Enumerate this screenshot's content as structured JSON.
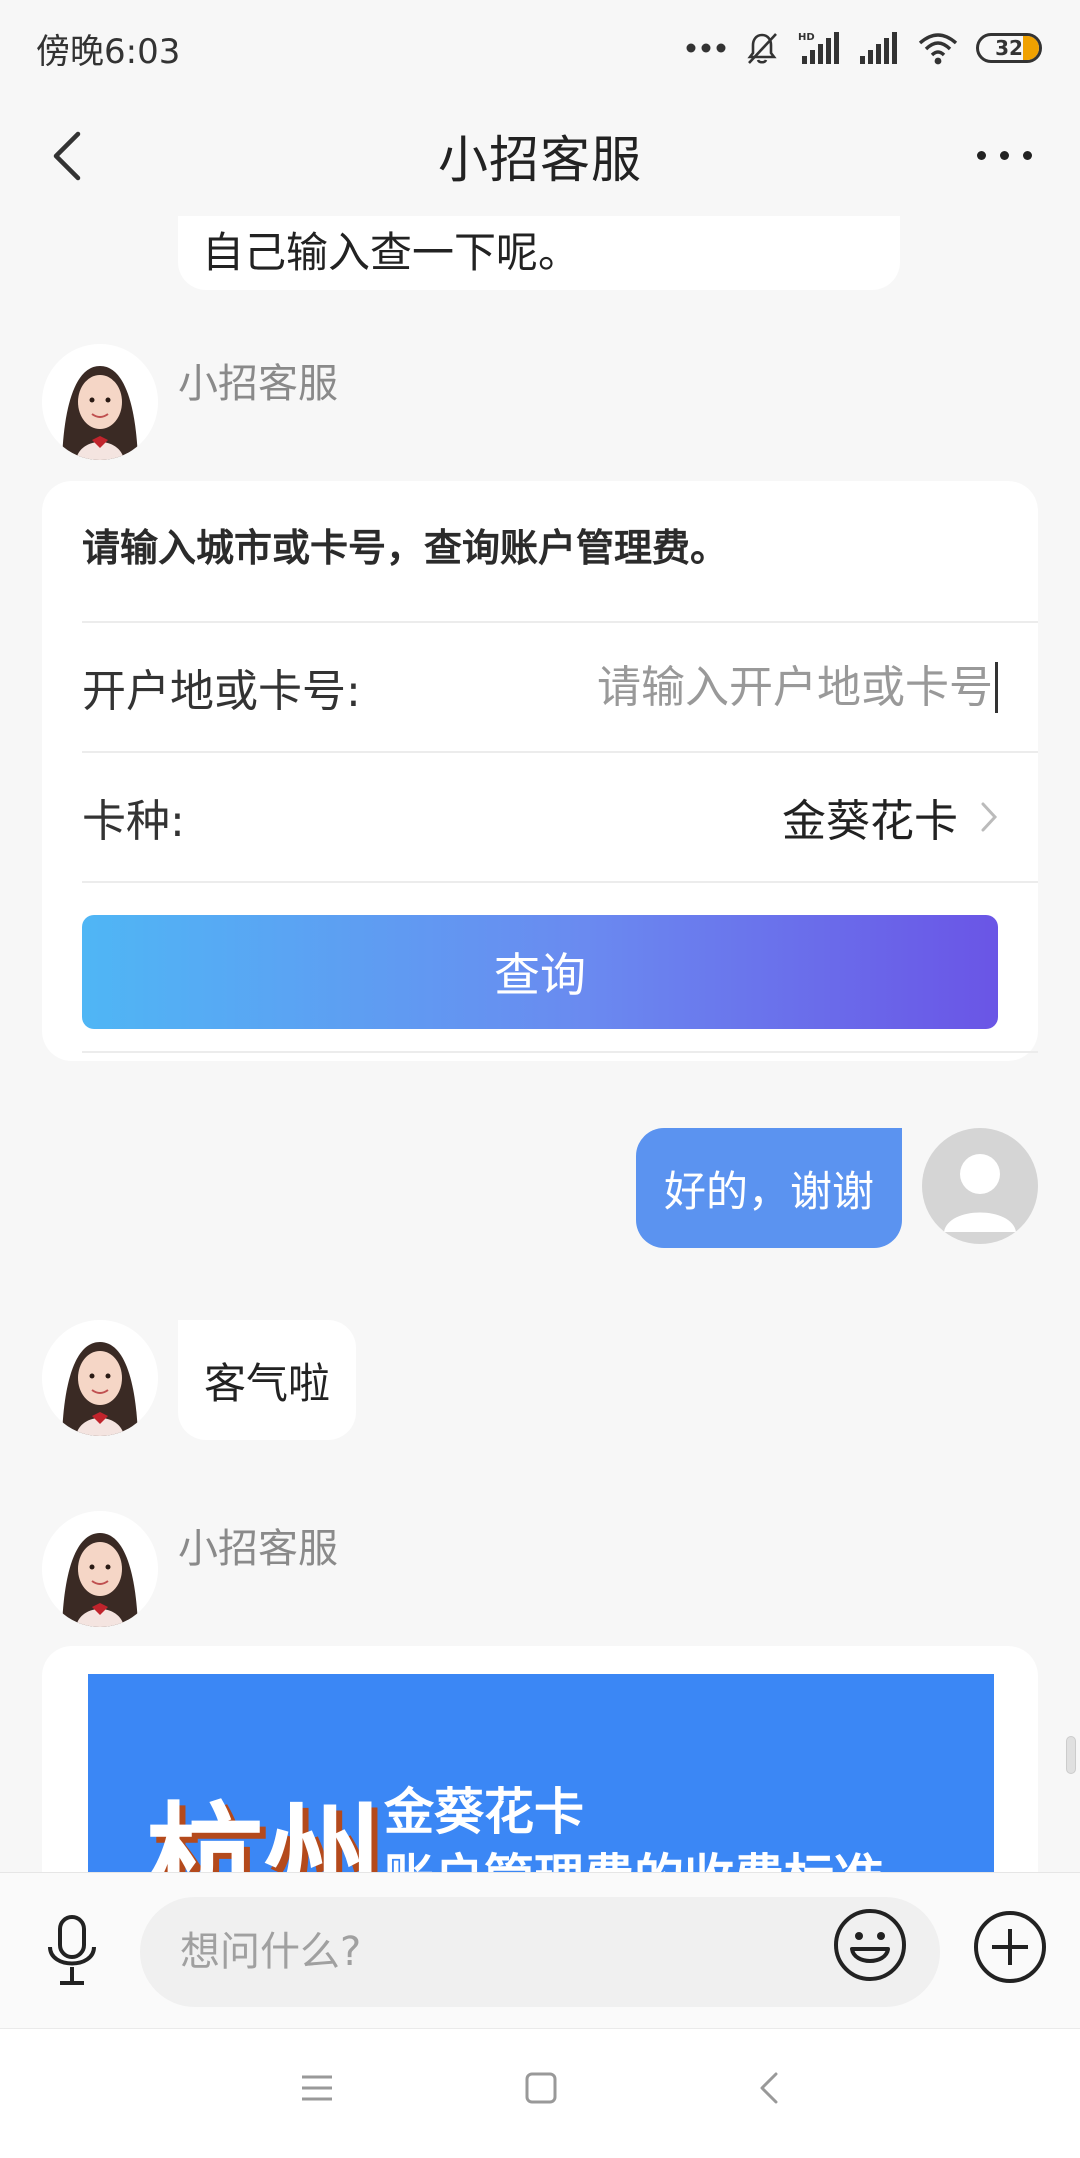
{
  "status_bar": {
    "time": "傍晚6:03",
    "battery": "32",
    "signal_label": "HD"
  },
  "header": {
    "title": "小招客服"
  },
  "chat": {
    "previous_message": "自己输入查一下呢。",
    "agent_name": "小招客服",
    "query_card": {
      "prompt": "请输入城市或卡号，查询账户管理费。",
      "location_label": "开户地或卡号:",
      "location_placeholder": "请输入开户地或卡号",
      "card_type_label": "卡种:",
      "card_type_value": "金葵花卡",
      "query_button": "查询"
    },
    "user_message": "好的，谢谢",
    "agent_reply": "客气啦",
    "agent_name_2": "小招客服",
    "banner": {
      "city": "杭州",
      "line1": "金葵花卡",
      "line2": "账户管理费的收费标准"
    }
  },
  "input_bar": {
    "placeholder": "想问什么?"
  },
  "colors": {
    "accent_blue": "#5b93f0",
    "button_gradient_start": "#4fb6f5",
    "button_gradient_end": "#6a55e6",
    "banner_blue": "#3b87f5"
  }
}
